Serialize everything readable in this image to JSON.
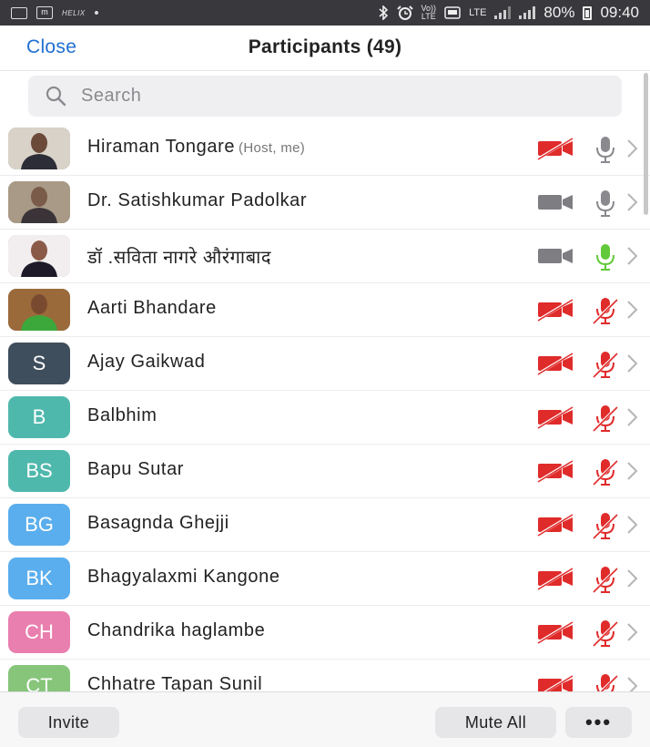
{
  "status_bar": {
    "volte": "Vo))",
    "lte_small": "LTE",
    "lte_label": "LTE",
    "battery": "80%",
    "time": "09:40",
    "icons": [
      "gallery-icon",
      "m-app-icon",
      "helix-icon",
      "dot-icon",
      "bluetooth-icon",
      "alarm-icon",
      "volte-icon",
      "hd-icon",
      "lte-icon",
      "signal-icon",
      "signal-icon",
      "battery-icon"
    ],
    "helix_text": "HELIX",
    "m_text": "m"
  },
  "header": {
    "close_label": "Close",
    "title": "Participants (49)"
  },
  "search": {
    "placeholder": "Search"
  },
  "colors": {
    "accent": "#1f6fd1",
    "muted_red": "#e02b2b",
    "active_green": "#62c93a",
    "icon_gray": "#8e8e93"
  },
  "participants": [
    {
      "name": "Hiraman Tongare",
      "role": "(Host, me)",
      "avatar": "photo",
      "video": "off",
      "audio": "on"
    },
    {
      "name": "Dr. Satishkumar Padolkar",
      "role": "",
      "avatar": "photo",
      "video": "on",
      "audio": "on"
    },
    {
      "name": "डॉ .सविता नागरे औरंगाबाद",
      "role": "",
      "avatar": "photo",
      "video": "on",
      "audio": "speaking"
    },
    {
      "name": "Aarti Bhandare",
      "role": "",
      "avatar": "photo",
      "video": "off",
      "audio": "muted"
    },
    {
      "name": "Ajay Gaikwad",
      "role": "",
      "initials": "S",
      "avatar_color": "#3f4e5c",
      "video": "off",
      "audio": "muted"
    },
    {
      "name": "Balbhim",
      "role": "",
      "initials": "B",
      "avatar_color": "#4fb8ac",
      "video": "off",
      "audio": "muted"
    },
    {
      "name": "Bapu Sutar",
      "role": "",
      "initials": "BS",
      "avatar_color": "#4fb8ac",
      "video": "off",
      "audio": "muted"
    },
    {
      "name": "Basagnda Ghejji",
      "role": "",
      "initials": "BG",
      "avatar_color": "#5aaeed",
      "video": "off",
      "audio": "muted"
    },
    {
      "name": "Bhagyalaxmi Kangone",
      "role": "",
      "initials": "BK",
      "avatar_color": "#5aaeed",
      "video": "off",
      "audio": "muted"
    },
    {
      "name": "Chandrika haglambe",
      "role": "",
      "initials": "CH",
      "avatar_color": "#e97fae",
      "video": "off",
      "audio": "muted"
    },
    {
      "name": "Chhatre Tapan Sunil",
      "role": "",
      "initials": "CT",
      "avatar_color": "#86c57a",
      "video": "off",
      "audio": "muted"
    }
  ],
  "footer": {
    "invite_label": "Invite",
    "mute_all_label": "Mute All",
    "more_label": "•••"
  }
}
